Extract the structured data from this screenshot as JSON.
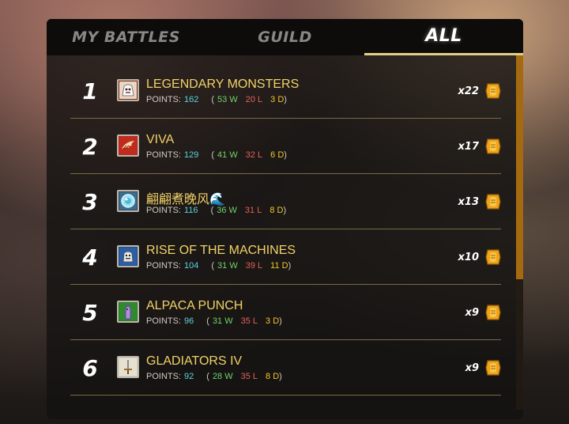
{
  "tabs": [
    {
      "label": "MY BATTLES",
      "active": false
    },
    {
      "label": "GUILD",
      "active": false
    },
    {
      "label": "ALL",
      "active": true
    }
  ],
  "labels": {
    "points": "POINTS:"
  },
  "colors": {
    "gold": "#f2d267",
    "points": "#59d3dc",
    "wins": "#6fd26a",
    "losses": "#e0605a",
    "draws": "#f2c52a",
    "scroll": "#a56a10"
  },
  "rows": [
    {
      "rank": "1",
      "name": "LEGENDARY MONSTERS",
      "points": "162",
      "wins": "53 W",
      "losses": "20 L",
      "draws": "3 D",
      "multiplier": "x22",
      "crest": "monster-crest-icon"
    },
    {
      "rank": "2",
      "name": "VIVA",
      "points": "129",
      "wins": "41 W",
      "losses": "32 L",
      "draws": "6 D",
      "multiplier": "x17",
      "crest": "wing-crest-icon"
    },
    {
      "rank": "3",
      "name": "翩翩煮晚风🌊",
      "points": "116",
      "wins": "36 W",
      "losses": "31 L",
      "draws": "8 D",
      "multiplier": "x13",
      "crest": "orb-crest-icon"
    },
    {
      "rank": "4",
      "name": "RISE OF THE MACHINES",
      "points": "104",
      "wins": "31 W",
      "losses": "39 L",
      "draws": "11 D",
      "multiplier": "x10",
      "crest": "robot-crest-icon"
    },
    {
      "rank": "5",
      "name": "ALPACA PUNCH",
      "points": "96",
      "wins": "31 W",
      "losses": "35 L",
      "draws": "3 D",
      "multiplier": "x9",
      "crest": "alpaca-crest-icon"
    },
    {
      "rank": "6",
      "name": "GLADIATORS IV",
      "points": "92",
      "wins": "28 W",
      "losses": "35 L",
      "draws": "8 D",
      "multiplier": "x9",
      "crest": "sword-crest-icon"
    }
  ]
}
